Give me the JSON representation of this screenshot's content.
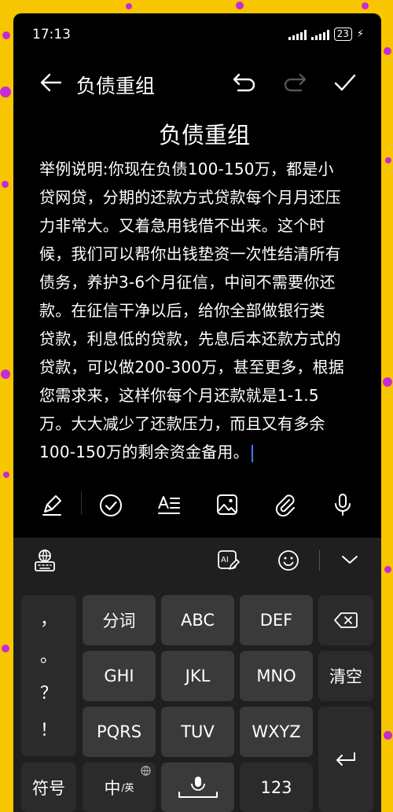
{
  "status_bar": {
    "time": "17:13",
    "battery": "23"
  },
  "title_bar": {
    "title": "负债重组"
  },
  "document": {
    "title": "负债重组",
    "lines": [
      "举例说明:你现在负债100-150万，都是小",
      "贷网贷，分期的还款方式贷款每个月月还压",
      "力非常大。又着急用钱借不出来。这个时",
      "候，我们可以帮你出钱垫资一次性结清所有",
      "债务，养护3-6个月征信，中间不需要你还",
      "款。在征信干净以后，给你全部做银行类",
      "贷款，利息低的贷款，先息后本还款方式的",
      "贷款，可以做200-300万，甚至更多，根据",
      "您需求来，这样你每个月还款就是1-1.5",
      "万。大大减少了还款压力，而且又有多余",
      "100-150万的剩余资金备用。"
    ]
  },
  "keyboard": {
    "punct": [
      "，",
      "。",
      "？",
      "！"
    ],
    "row1": [
      "分词",
      "ABC",
      "DEF"
    ],
    "row2": [
      "GHI",
      "JKL",
      "MNO",
      "清空"
    ],
    "row3": [
      "PQRS",
      "TUV",
      "WXYZ"
    ],
    "bottom": {
      "symbols": "符号",
      "lang_main": "中",
      "lang_sub": "/英",
      "numbers": "123"
    }
  }
}
